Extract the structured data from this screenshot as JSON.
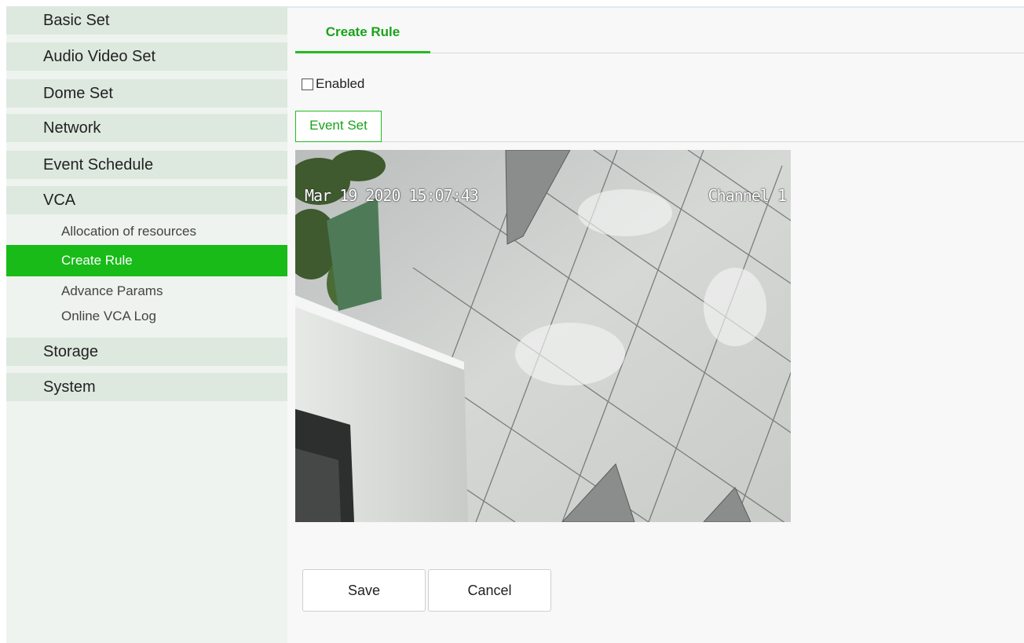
{
  "sidebar": {
    "menu": {
      "basic_set": "Basic Set",
      "audio_video_set": "Audio Video Set",
      "dome_set": "Dome Set",
      "network": "Network",
      "event_schedule": "Event Schedule",
      "vca": "VCA",
      "storage": "Storage",
      "system": "System"
    },
    "vca_sub": {
      "allocation": "Allocation of resources",
      "create_rule": "Create Rule",
      "advance_params": "Advance Params",
      "online_log": "Online VCA Log"
    },
    "active_item": "Create Rule"
  },
  "main": {
    "tab_label": "Create Rule",
    "enabled_label": "Enabled",
    "enabled_checked": false,
    "event_set_label": "Event Set",
    "video": {
      "timestamp": "Mar 19 2020 15:07:43",
      "channel": "Channel 1"
    },
    "buttons": {
      "save": "Save",
      "cancel": "Cancel"
    }
  },
  "colors": {
    "accent": "#22bb22",
    "active_bg": "#18bb18",
    "menu_bg": "#dde8df",
    "sidebar_bg": "#eef3ef"
  }
}
